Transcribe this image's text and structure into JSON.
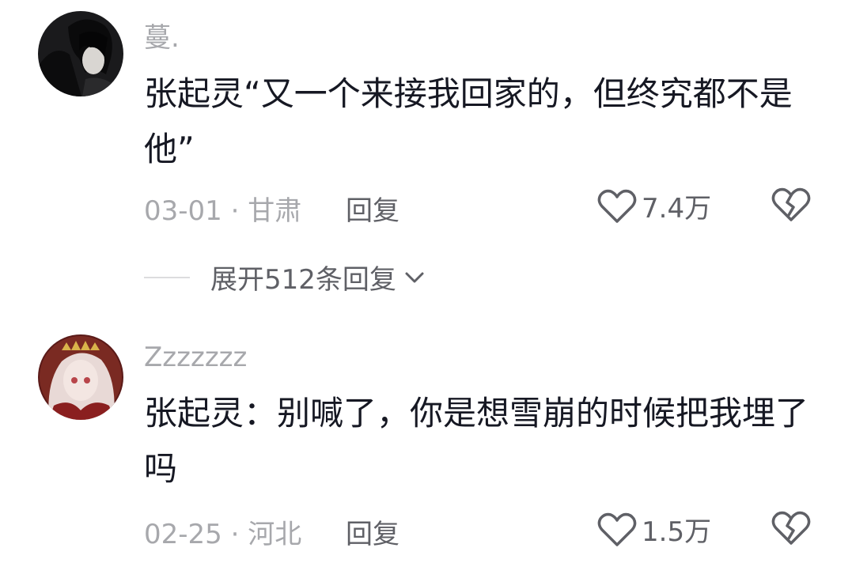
{
  "comments": [
    {
      "username": "蔓.",
      "text": "张起灵“又一个来接我回家的，但终究都不是他”",
      "date": "03-01",
      "separator": "·",
      "location": "甘肃",
      "reply_label": "回复",
      "like_count": "7.4万",
      "expand_label": "展开512条回复",
      "avatar_icon": "dark-hair-avatar-icon"
    },
    {
      "username": "Zzzzzzz",
      "text": "张起灵：别喊了，你是想雪崩的时候把我埋了吗",
      "date": "02-25",
      "separator": "·",
      "location": "河北",
      "reply_label": "回复",
      "like_count": "1.5万",
      "avatar_icon": "white-hair-avatar-icon"
    }
  ],
  "colors": {
    "primary_text": "#161823",
    "secondary_text": "#a7a8ac",
    "action_text": "#5f6066",
    "background": "#ffffff"
  }
}
